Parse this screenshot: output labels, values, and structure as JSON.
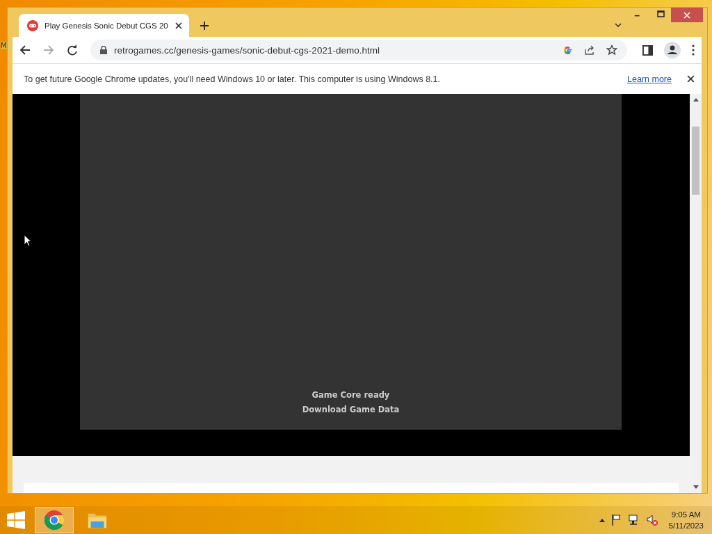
{
  "desktop": {
    "label_fragment": "M"
  },
  "tabs": [
    {
      "title": "Play Genesis Sonic Debut CGS 20",
      "selected": true
    }
  ],
  "address_bar": {
    "url": "retrogames.cc/genesis-games/sonic-debut-cgs-2021-demo.html"
  },
  "infobar": {
    "message": "To get future Google Chrome updates, you'll need Windows 10 or later. This computer is using Windows 8.1.",
    "link": "Learn more"
  },
  "game": {
    "status": "Game Core ready",
    "action": "Download Game Data"
  },
  "taskbar": {
    "apps": [
      {
        "kind": "chrome",
        "selected": true
      },
      {
        "kind": "explorer",
        "selected": false
      }
    ],
    "clock": {
      "time": "9:05 AM",
      "date": "5/11/2023"
    }
  }
}
